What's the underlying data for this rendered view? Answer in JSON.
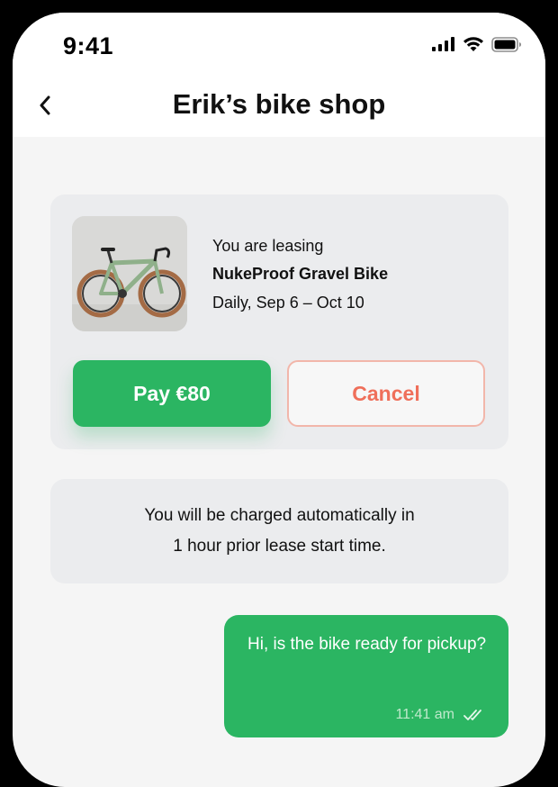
{
  "status_bar": {
    "time": "9:41"
  },
  "header": {
    "title": "Erik’s bike shop",
    "back_icon": "chevron-left-icon"
  },
  "lease_card": {
    "intro": "You are leasing",
    "item_name": "NukeProof Gravel Bike",
    "schedule": "Daily, Sep 6 – Oct 10",
    "pay_label": "Pay €80",
    "cancel_label": "Cancel"
  },
  "notice": {
    "line1": "You will be charged automatically in",
    "line2": "1 hour prior lease start time."
  },
  "message": {
    "text": "Hi, is the bike ready for pickup?",
    "time": "11:41 am",
    "status_icon": "double-check-icon"
  },
  "colors": {
    "accent_green": "#2bb562",
    "cancel_red": "#ef6f5a",
    "card_bg": "#ebecee"
  }
}
